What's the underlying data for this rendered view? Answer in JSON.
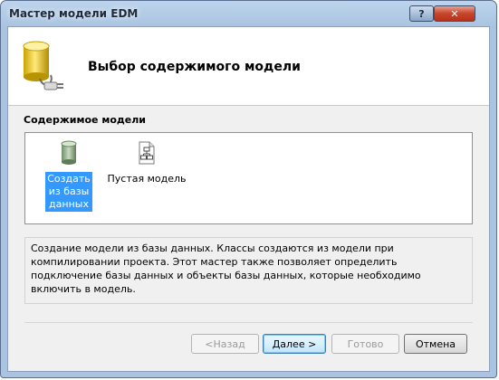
{
  "window": {
    "title": "Мастер модели EDM",
    "help_button": "?",
    "close_button": "✕"
  },
  "header": {
    "title": "Выбор содержимого модели",
    "icon": "database-plug-icon"
  },
  "content": {
    "section_label": "Содержимое модели",
    "options": [
      {
        "label_line1": "Создать",
        "label_line2": "из базы",
        "label_line3": "данных",
        "icon": "database-icon",
        "selected": true
      },
      {
        "label": "Пустая модель",
        "icon": "empty-model-icon",
        "selected": false
      }
    ],
    "description": "Создание модели из базы данных. Классы создаются из модели при компилировании проекта. Этот мастер также позволяет определить подключение базы данных и объекты базы данных, которые необходимо включить в модель."
  },
  "buttons": {
    "back": "<Назад",
    "next": "Далее >",
    "finish": "Готово",
    "cancel": "Отмена"
  },
  "colors": {
    "selection": "#3399ff",
    "titlebar": "#a9c3e0"
  }
}
